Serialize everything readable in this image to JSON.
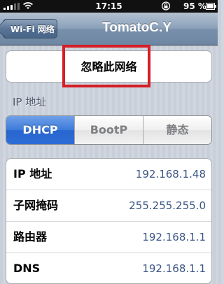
{
  "status_bar": {
    "time": "17:15",
    "battery_percent": "95 %",
    "signal_icon": "signal-bars-icon",
    "wifi_icon": "wifi-icon",
    "lock_icon": "orientation-lock-icon",
    "battery_icon": "battery-icon"
  },
  "nav": {
    "back_label": "Wi-Fi 网络",
    "title": "TomatoC.Y"
  },
  "forget": {
    "label": "忽略此网络",
    "highlight_color": "#d71d25"
  },
  "ip_section": {
    "header": "IP 地址",
    "segments": [
      "DHCP",
      "BootP",
      "静态"
    ],
    "selected": "DHCP"
  },
  "details": [
    {
      "label": "IP 地址",
      "value": "192.168.1.48"
    },
    {
      "label": "子网掩码",
      "value": "255.255.255.0"
    },
    {
      "label": "路由器",
      "value": "192.168.1.1"
    },
    {
      "label": "DNS",
      "value": "192.168.1.1"
    }
  ],
  "colors": {
    "accent_blue": "#2f6dd6",
    "value_text": "#3b5685",
    "nav_bar": "#7890ab"
  }
}
